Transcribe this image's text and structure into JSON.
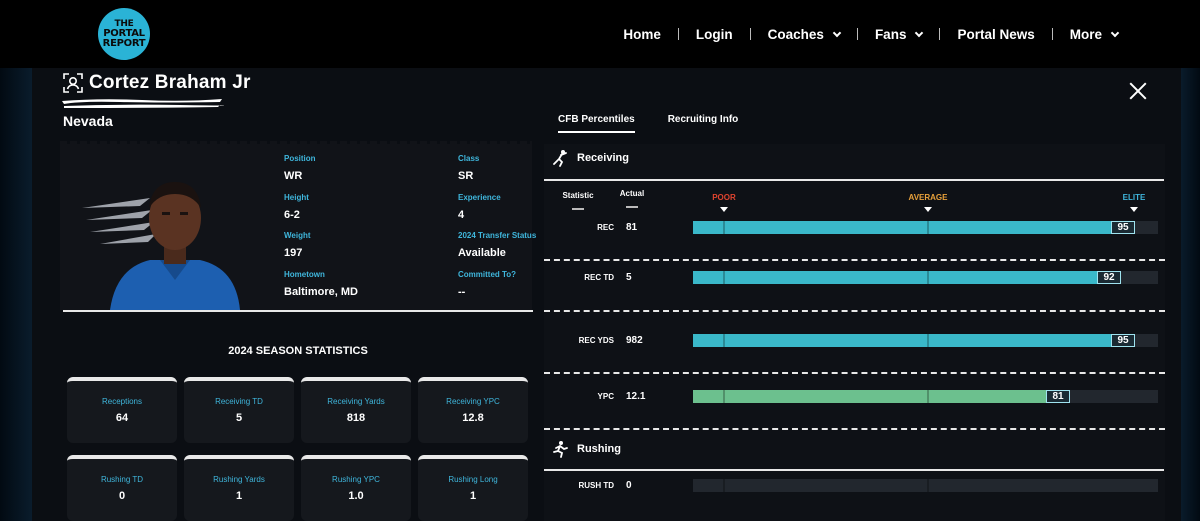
{
  "logo": {
    "line1": "THE",
    "line2": "PORTAL",
    "line3": "REPORT"
  },
  "nav": [
    {
      "label": "Home",
      "dropdown": false
    },
    {
      "label": "Login",
      "dropdown": false
    },
    {
      "label": "Coaches",
      "dropdown": true
    },
    {
      "label": "Fans",
      "dropdown": true
    },
    {
      "label": "Portal News",
      "dropdown": false
    },
    {
      "label": "More",
      "dropdown": true
    }
  ],
  "player": {
    "name": "Cortez Braham Jr",
    "school": "Nevada",
    "fields": {
      "position_label": "Position",
      "position": "WR",
      "class_label": "Class",
      "class": "SR",
      "height_label": "Height",
      "height": "6-2",
      "experience_label": "Experience",
      "experience": "4",
      "weight_label": "Weight",
      "weight": "197",
      "transfer_label": "2024 Transfer Status",
      "transfer": "Available",
      "hometown_label": "Hometown",
      "hometown": "Baltimore, MD",
      "committed_label": "Committed To?",
      "committed": "--"
    }
  },
  "tabs": {
    "percentiles": "CFB Percentiles",
    "recruiting": "Recruiting Info"
  },
  "season": {
    "title": "2024 SEASON STATISTICS",
    "boxes": [
      {
        "label": "Receptions",
        "value": "64"
      },
      {
        "label": "Receiving TD",
        "value": "5"
      },
      {
        "label": "Receiving Yards",
        "value": "818"
      },
      {
        "label": "Receiving YPC",
        "value": "12.8"
      },
      {
        "label": "Rushing TD",
        "value": "0"
      },
      {
        "label": "Rushing Yards",
        "value": "1"
      },
      {
        "label": "Rushing YPC",
        "value": "1.0"
      },
      {
        "label": "Rushing Long",
        "value": "1"
      }
    ]
  },
  "percentiles": {
    "receiving_title": "Receiving",
    "rushing_title": "Rushing",
    "col_statistic": "Statistic",
    "col_actual": "Actual",
    "scale": {
      "poor": "POOR",
      "average": "AVERAGE",
      "elite": "ELITE"
    },
    "colors": {
      "poor": "#e0442f",
      "average": "#e8a13a",
      "elite": "#3fb6dc",
      "bar_blue": "#3ab8c9",
      "bar_green": "#6cc08e"
    },
    "rows": [
      {
        "stat": "REC",
        "actual": "81",
        "percentile": 95,
        "color": "blue"
      },
      {
        "stat": "REC TD",
        "actual": "5",
        "percentile": 92,
        "color": "blue"
      },
      {
        "stat": "REC YDS",
        "actual": "982",
        "percentile": 95,
        "color": "blue"
      },
      {
        "stat": "YPC",
        "actual": "12.1",
        "percentile": 81,
        "color": "green"
      }
    ],
    "rushing_rows": [
      {
        "stat": "RUSH TD",
        "actual": "0",
        "percentile": null
      }
    ]
  }
}
